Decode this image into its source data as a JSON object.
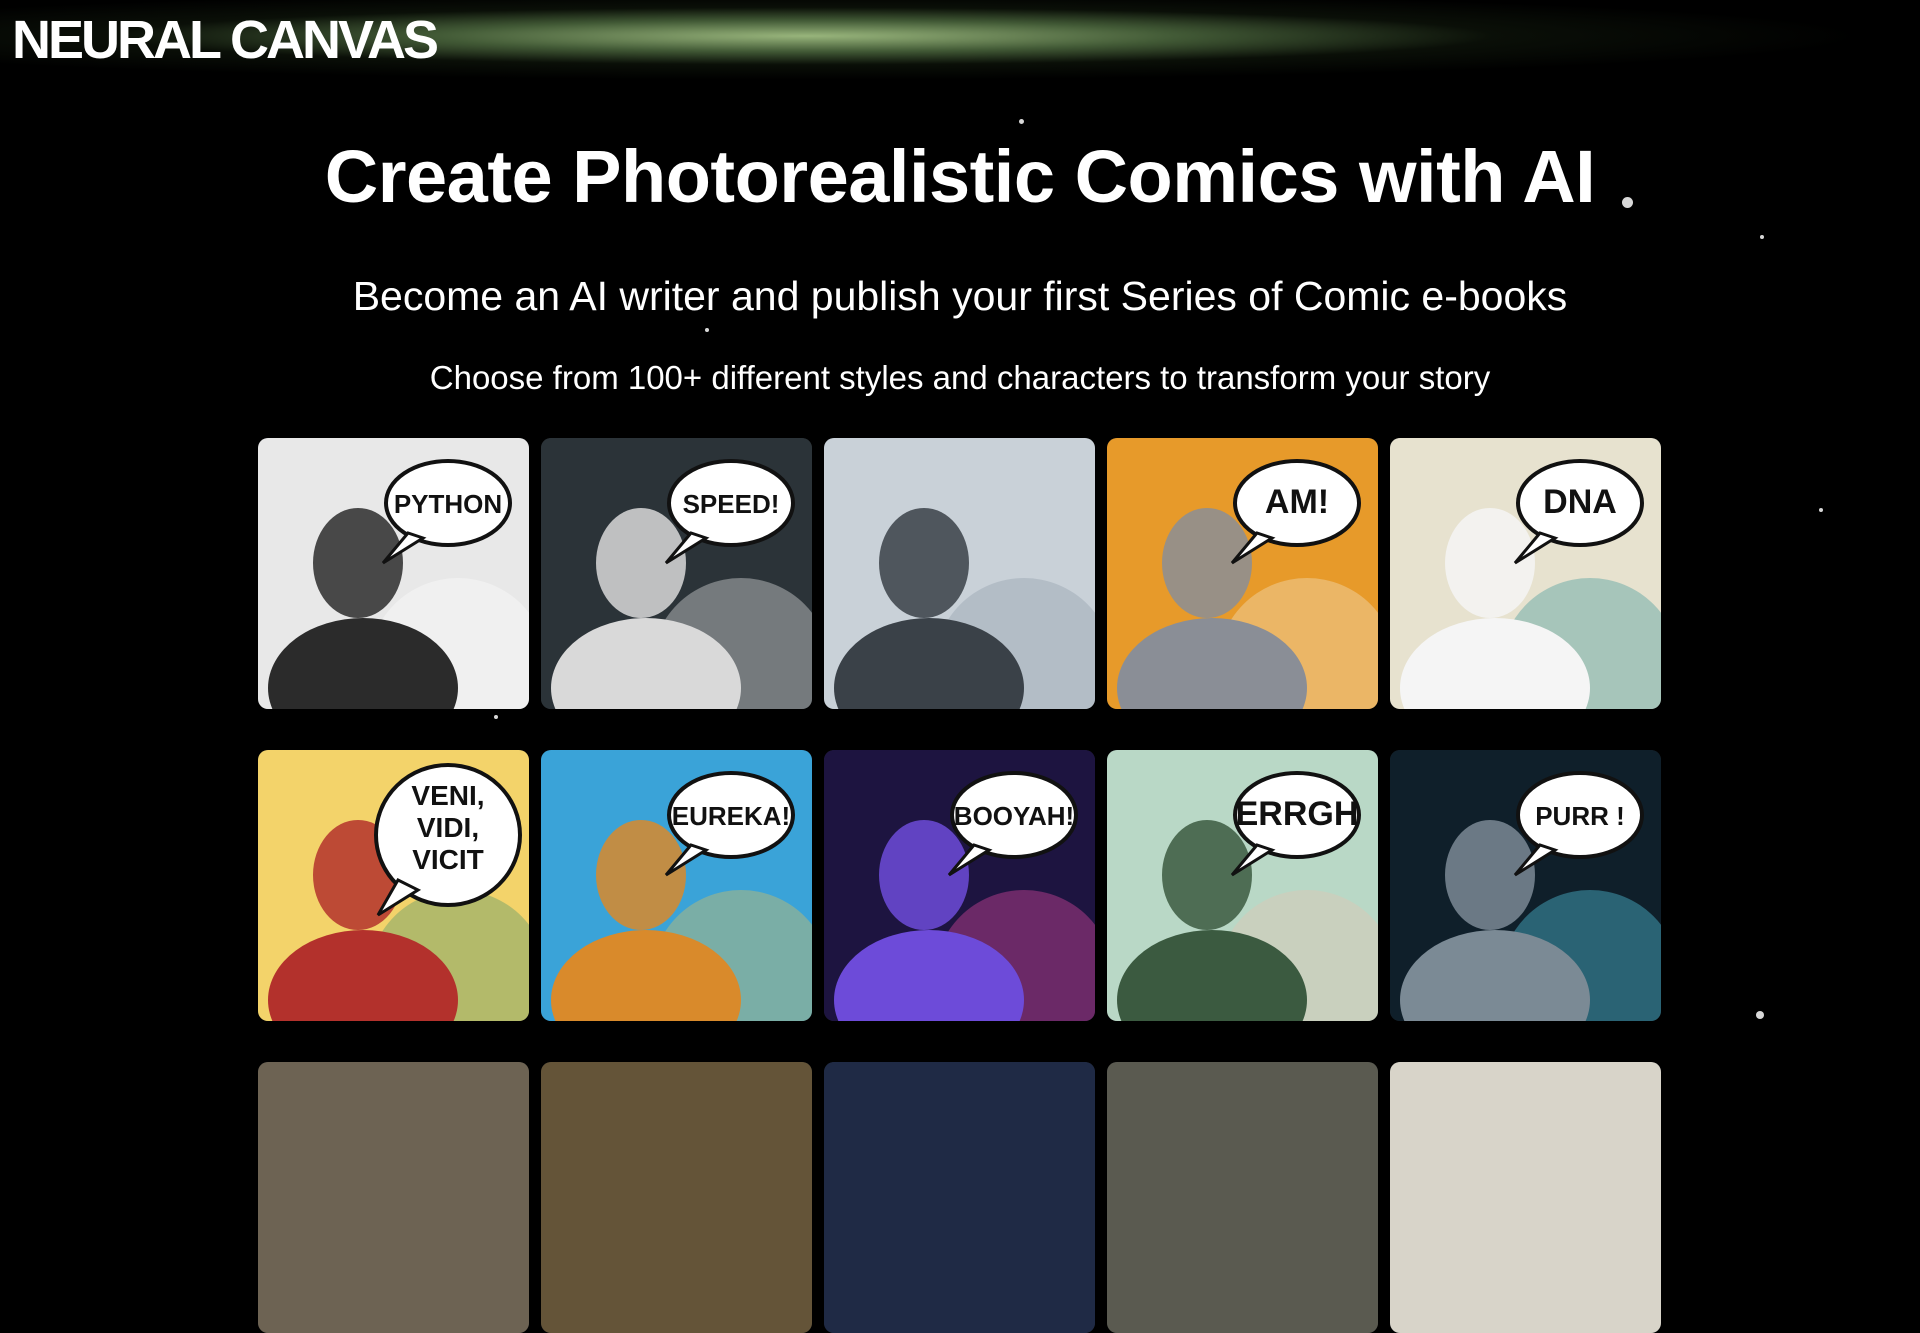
{
  "brand": {
    "logo": "NEURAL CANVAS"
  },
  "hero": {
    "title": "Create Photorealistic Comics with AI",
    "subtitle": "Become an AI writer and publish your first Series of Comic e-books",
    "tagline": "Choose from 100+ different styles and characters to transform your story"
  },
  "gallery": {
    "tiles": [
      {
        "name": "victorian-woman",
        "caption": "PYTHON",
        "bg": "#e8e8e8",
        "figure": "#2b2b2b",
        "accent": "#ffffff"
      },
      {
        "name": "einstein-portrait",
        "caption": "SPEED!",
        "bg": "#2b3338",
        "figure": "#d9d9d9",
        "accent": "#ffffff"
      },
      {
        "name": "einstein-racing",
        "caption": "",
        "bg": "#c9d1d8",
        "figure": "#3a4148",
        "accent": "#8a98a6"
      },
      {
        "name": "knight-woman",
        "caption": "AM!",
        "bg": "#e79a2a",
        "figure": "#8a8e96",
        "accent": "#f4ecd6"
      },
      {
        "name": "scientist-dna",
        "caption": "DNA",
        "bg": "#e7e2cf",
        "figure": "#f5f5f5",
        "accent": "#2f8f93"
      },
      {
        "name": "caesar",
        "caption": "VENI, VIDI, VICIT",
        "bg": "#f3d36a",
        "figure": "#b3312c",
        "accent": "#3b8b6b"
      },
      {
        "name": "archimedes",
        "caption": "EUREKA!",
        "bg": "#3aa3d8",
        "figure": "#d98a2b",
        "accent": "#f3c34a"
      },
      {
        "name": "neon-zeus",
        "caption": "BOOYAH!",
        "bg": "#1d1440",
        "figure": "#6d4bd9",
        "accent": "#ff4fb3"
      },
      {
        "name": "medusa",
        "caption": "ERRGH",
        "bg": "#b9d8c6",
        "figure": "#3b5a40",
        "accent": "#e9c4ae"
      },
      {
        "name": "robot-cat",
        "caption": "PURR !",
        "bg": "#0f1f2a",
        "figure": "#7b8a95",
        "accent": "#5fe3ff"
      },
      {
        "name": "tile-11",
        "caption": "",
        "bg": "#6d6353",
        "figure": "#6d6353",
        "accent": "#6d6353"
      },
      {
        "name": "tile-12",
        "caption": "",
        "bg": "#645438",
        "figure": "#645438",
        "accent": "#645438"
      },
      {
        "name": "tile-13",
        "caption": "",
        "bg": "#1f2a45",
        "figure": "#1f2a45",
        "accent": "#1f2a45"
      },
      {
        "name": "tile-14",
        "caption": "",
        "bg": "#5a5a50",
        "figure": "#5a5a50",
        "accent": "#5a5a50"
      },
      {
        "name": "tile-15",
        "caption": "",
        "bg": "#d8d4c9",
        "figure": "#d8d4c9",
        "accent": "#d8d4c9"
      }
    ]
  }
}
